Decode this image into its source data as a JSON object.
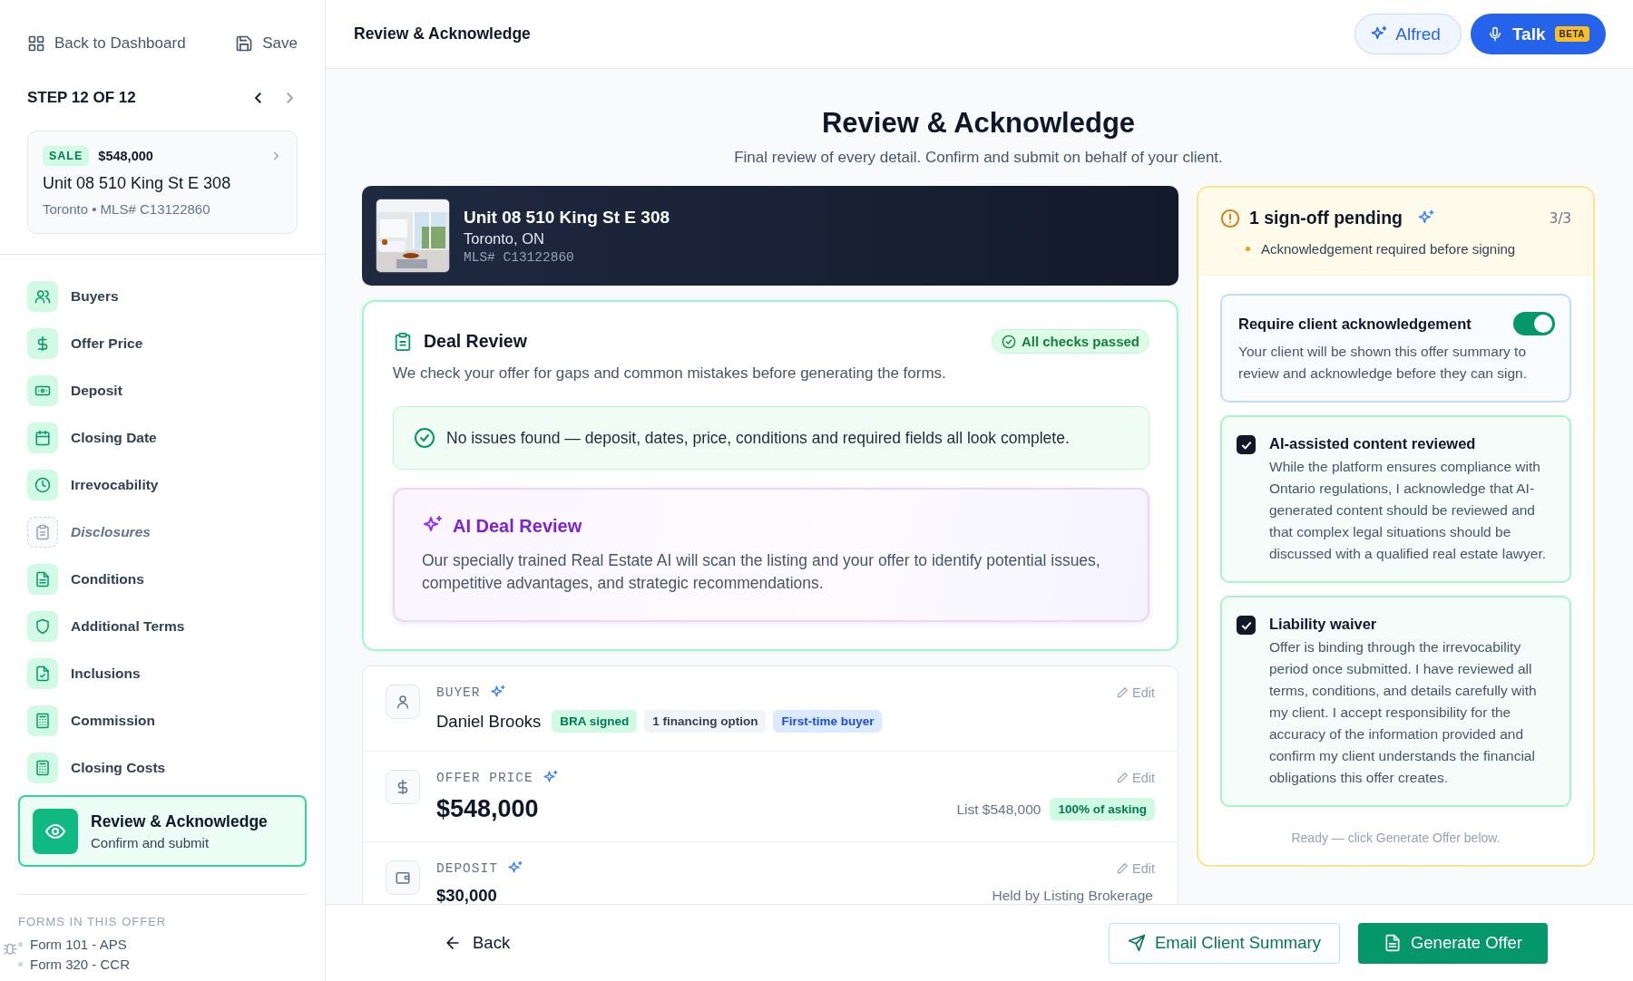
{
  "sidebar": {
    "back_link": "Back to Dashboard",
    "save_button": "Save",
    "step_label": "STEP 12 OF 12",
    "prev_disabled": false,
    "next_disabled": true,
    "listing_card": {
      "tag": "SALE",
      "price": "$548,000",
      "address": "Unit 08 510 King St E 308",
      "meta": "Toronto • MLS# C13122860"
    },
    "steps": [
      {
        "label": "Buyers",
        "completed": true,
        "selected": false
      },
      {
        "label": "Offer Price",
        "completed": true,
        "selected": false
      },
      {
        "label": "Deposit",
        "completed": true,
        "selected": false
      },
      {
        "label": "Closing Date",
        "completed": true,
        "selected": false
      },
      {
        "label": "Irrevocability",
        "completed": true,
        "selected": false
      },
      {
        "label": "Disclosures",
        "completed": false,
        "selected": false
      },
      {
        "label": "Conditions",
        "completed": true,
        "selected": false
      },
      {
        "label": "Additional Terms",
        "completed": true,
        "selected": false
      },
      {
        "label": "Inclusions",
        "completed": true,
        "selected": false
      },
      {
        "label": "Commission",
        "completed": true,
        "selected": false
      },
      {
        "label": "Closing Costs",
        "completed": true,
        "selected": false
      },
      {
        "label": "Review & Acknowledge",
        "subtitle": "Confirm and submit",
        "completed": true,
        "selected": true
      }
    ],
    "forms": {
      "heading": "FORMS IN THIS OFFER",
      "items": [
        "Form 101 - APS",
        "Form 320 - CCR"
      ]
    }
  },
  "header": {
    "title": "Review & Acknowledge",
    "assistant_button": "Alfred",
    "talk_button": {
      "label": "Talk",
      "badge": "BETA"
    }
  },
  "page": {
    "title": "Review & Acknowledge",
    "subtitle": "Final review of every detail. Confirm and submit on behalf of your client."
  },
  "property": {
    "address": "Unit 08 510 King St E 308",
    "city": "Toronto, ON",
    "mls": "MLS# C13122860"
  },
  "deal_review": {
    "title": "Deal Review",
    "status": "All checks passed",
    "description": "We check your offer for gaps and common mistakes before generating the forms.",
    "result": "No issues found — deposit, dates, price, conditions and required fields all look complete.",
    "ai_review": {
      "title": "AI Deal Review",
      "description": "Our specially trained Real Estate AI will scan the listing and your offer to identify potential issues, competitive advantages, and strategic recommendations."
    }
  },
  "summary_rows": [
    {
      "kind": "person",
      "label": "BUYER",
      "ai": true,
      "edit": "Edit",
      "value": "Daniel Brooks",
      "tags": [
        {
          "text": "BRA signed",
          "kind": "success"
        },
        {
          "text": "1 financing option",
          "kind": "neutral"
        },
        {
          "text": "First-time buyer",
          "kind": "info"
        }
      ]
    },
    {
      "kind": "price",
      "label": "OFFER PRICE",
      "ai": true,
      "edit": "Edit",
      "value": "$548,000",
      "note": "List $548,000",
      "tags": [
        {
          "text": "100% of asking",
          "kind": "success"
        }
      ]
    },
    {
      "kind": "amount",
      "label": "DEPOSIT",
      "ai": true,
      "edit": "Edit",
      "value": "$30,000",
      "note": "Held by Listing Brokerage",
      "tags": []
    }
  ],
  "signoff": {
    "title": "1 sign-off pending",
    "ai": true,
    "count": "3/3",
    "notes": [
      "Acknowledgement required before signing"
    ],
    "toggle": {
      "title": "Require client acknowledgement",
      "description": "Your client will be shown this offer summary to review and acknowledge before they can sign.",
      "on": true
    },
    "checks": [
      {
        "title": "AI-assisted content reviewed",
        "description": "While the platform ensures compliance with Ontario regulations, I acknowledge that AI-generated content should be reviewed and that complex legal situations should be discussed with a qualified real estate lawyer.",
        "checked": true
      },
      {
        "title": "Liability waiver",
        "description": "Offer is binding through the irrevocability period once submitted. I have reviewed all terms, conditions, and details carefully with my client. I accept responsibility for the accuracy of the information provided and confirm my client understands the financial obligations this offer creates.",
        "checked": true
      }
    ],
    "footer_note": "Ready — click Generate Offer below."
  },
  "footer": {
    "back_button": "Back",
    "email_button": "Email Client Summary",
    "generate_button": "Generate Offer"
  }
}
